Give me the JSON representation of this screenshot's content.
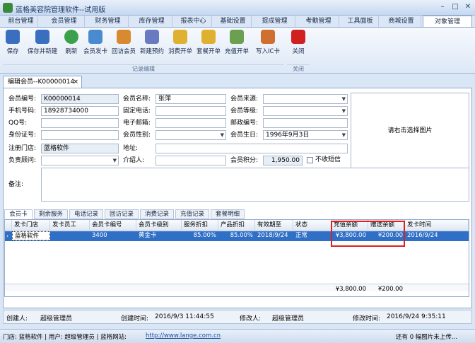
{
  "title": "蓝格美容院管理软件--试用版",
  "menu_tabs": [
    "前台管理",
    "会员管理",
    "财务管理",
    "库存管理",
    "报表中心",
    "基础设置",
    "提成管理",
    "考勤管理",
    "工具面板",
    "商城设置",
    "对象管理"
  ],
  "ribbon": {
    "buttons": [
      {
        "label": "保存",
        "icon": "save-icon",
        "color": "#3a6fc0"
      },
      {
        "label": "保存并新建",
        "icon": "save-new-icon",
        "color": "#3a6fc0"
      },
      {
        "label": "刷新",
        "icon": "refresh-icon",
        "color": "#3aa04a"
      },
      {
        "label": "会员发卡",
        "icon": "card-issue-icon",
        "color": "#4a8ad0"
      },
      {
        "label": "回访会员",
        "icon": "visit-icon",
        "color": "#d88a30"
      },
      {
        "label": "新建预约",
        "icon": "appointment-icon",
        "color": "#6a7ac0"
      },
      {
        "label": "消费开单",
        "icon": "consume-icon",
        "color": "#e0b030"
      },
      {
        "label": "套餐开单",
        "icon": "package-icon",
        "color": "#e0b030"
      },
      {
        "label": "充值开单",
        "icon": "recharge-icon",
        "color": "#6aa050"
      },
      {
        "label": "写入IC卡",
        "icon": "ic-card-icon",
        "color": "#d07030"
      },
      {
        "label": "关闭",
        "icon": "close-icon",
        "color": "#d02020"
      }
    ],
    "group_record": "记录编辑",
    "group_close": "关闭"
  },
  "doc_tab": "编辑会员--K00000014",
  "form": {
    "member_no_label": "会员编号:",
    "member_no": "K00000014",
    "member_name_label": "会员名称:",
    "member_name": "张萍",
    "source_label": "会员来源:",
    "source": "",
    "phone_label": "手机号码:",
    "phone": "18928734000",
    "tel_label": "固定电话:",
    "tel": "",
    "level_label": "会员等级:",
    "level": "",
    "qq_label": "QQ号:",
    "qq": "",
    "email_label": "电子邮箱:",
    "email": "",
    "zip_label": "邮政编号:",
    "zip": "",
    "id_label": "身份证号:",
    "id_no": "",
    "gender_label": "会员性别:",
    "gender": "",
    "birthday_label": "会员生日:",
    "birthday": "1996年9月3日",
    "store_label": "注册门店:",
    "store": "蓝格软件",
    "address_label": "地址:",
    "address": "",
    "advisor_label": "负责顾问:",
    "advisor": "",
    "referrer_label": "介绍人:",
    "referrer": "",
    "points_label": "会员积分:",
    "points": "1,950.00",
    "no_sms_label": "不收短信",
    "remark_label": "备注:",
    "remark": ""
  },
  "photo_text": "请右击选择图片",
  "sub_tabs": [
    "会员卡",
    "剩余服务",
    "电话记录",
    "回访记录",
    "消费记录",
    "充值记录",
    "套餐明细"
  ],
  "grid": {
    "headers": [
      "发卡门店",
      "发卡员工",
      "会员卡编号",
      "会员卡级别",
      "服务折扣",
      "产品折扣",
      "有效期至",
      "状态",
      "充值余额",
      "赠送余额",
      "发卡时间"
    ],
    "row": [
      "蓝格软件",
      "",
      "3400",
      "黄金卡",
      "85.00%",
      "85.00%",
      "2018/9/24",
      "正常",
      "¥3,800.00",
      "¥200.00",
      "2016/9/24"
    ],
    "total_recharge": "¥3,800.00",
    "total_gift": "¥200.00"
  },
  "footer": {
    "creator_label": "创建人:",
    "creator": "超级管理员",
    "create_time_label": "创建时间:",
    "create_time": "2016/9/3 11:44:55",
    "modifier_label": "修改人:",
    "modifier": "超级管理员",
    "modify_time_label": "修改时间:",
    "modify_time": "2016/9/24 9:35:11"
  },
  "status": {
    "text": "门店: 蓝格软件 | 用户: 超级管理员 | 蓝格网站:",
    "url": "http://www.lange.com.cn",
    "right": "还有 0 幅图片未上传..."
  }
}
